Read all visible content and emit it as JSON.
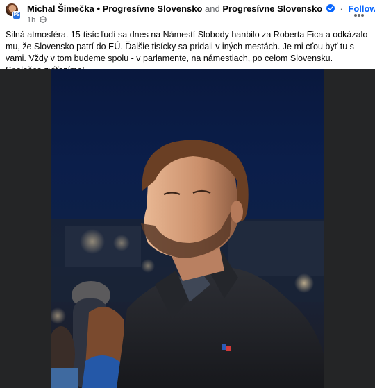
{
  "post": {
    "author": "Michal Šimečka",
    "separator": "•",
    "page_name_1": "Progresívne Slovensko",
    "conjunction": "and",
    "page_name_2": "Progresívne Slovensko",
    "dot": "·",
    "follow_label": "Follow",
    "time": "1h",
    "privacy_icon": "globe-icon",
    "more_icon": "more-options-icon",
    "text": "Silná atmosféra. 15-tisíc ľudí sa dnes na Námestí Slobody hanbilo za Roberta Fica a odkázalo mu, že Slovensko patrí do EÚ. Ďalšie tisícky sa pridali v iných mestách. Je mi cťou byť tu s vami. Vždy v tom budeme spolu - v parlamente, na námestiach, po celom Slovensku. Spoločne zvíťazíme!"
  },
  "colors": {
    "follow": "#0866ff",
    "verified": "#0866ff",
    "secondary_text": "#65676b",
    "photo_background": "#242526",
    "sky": "#0b1e4a"
  }
}
